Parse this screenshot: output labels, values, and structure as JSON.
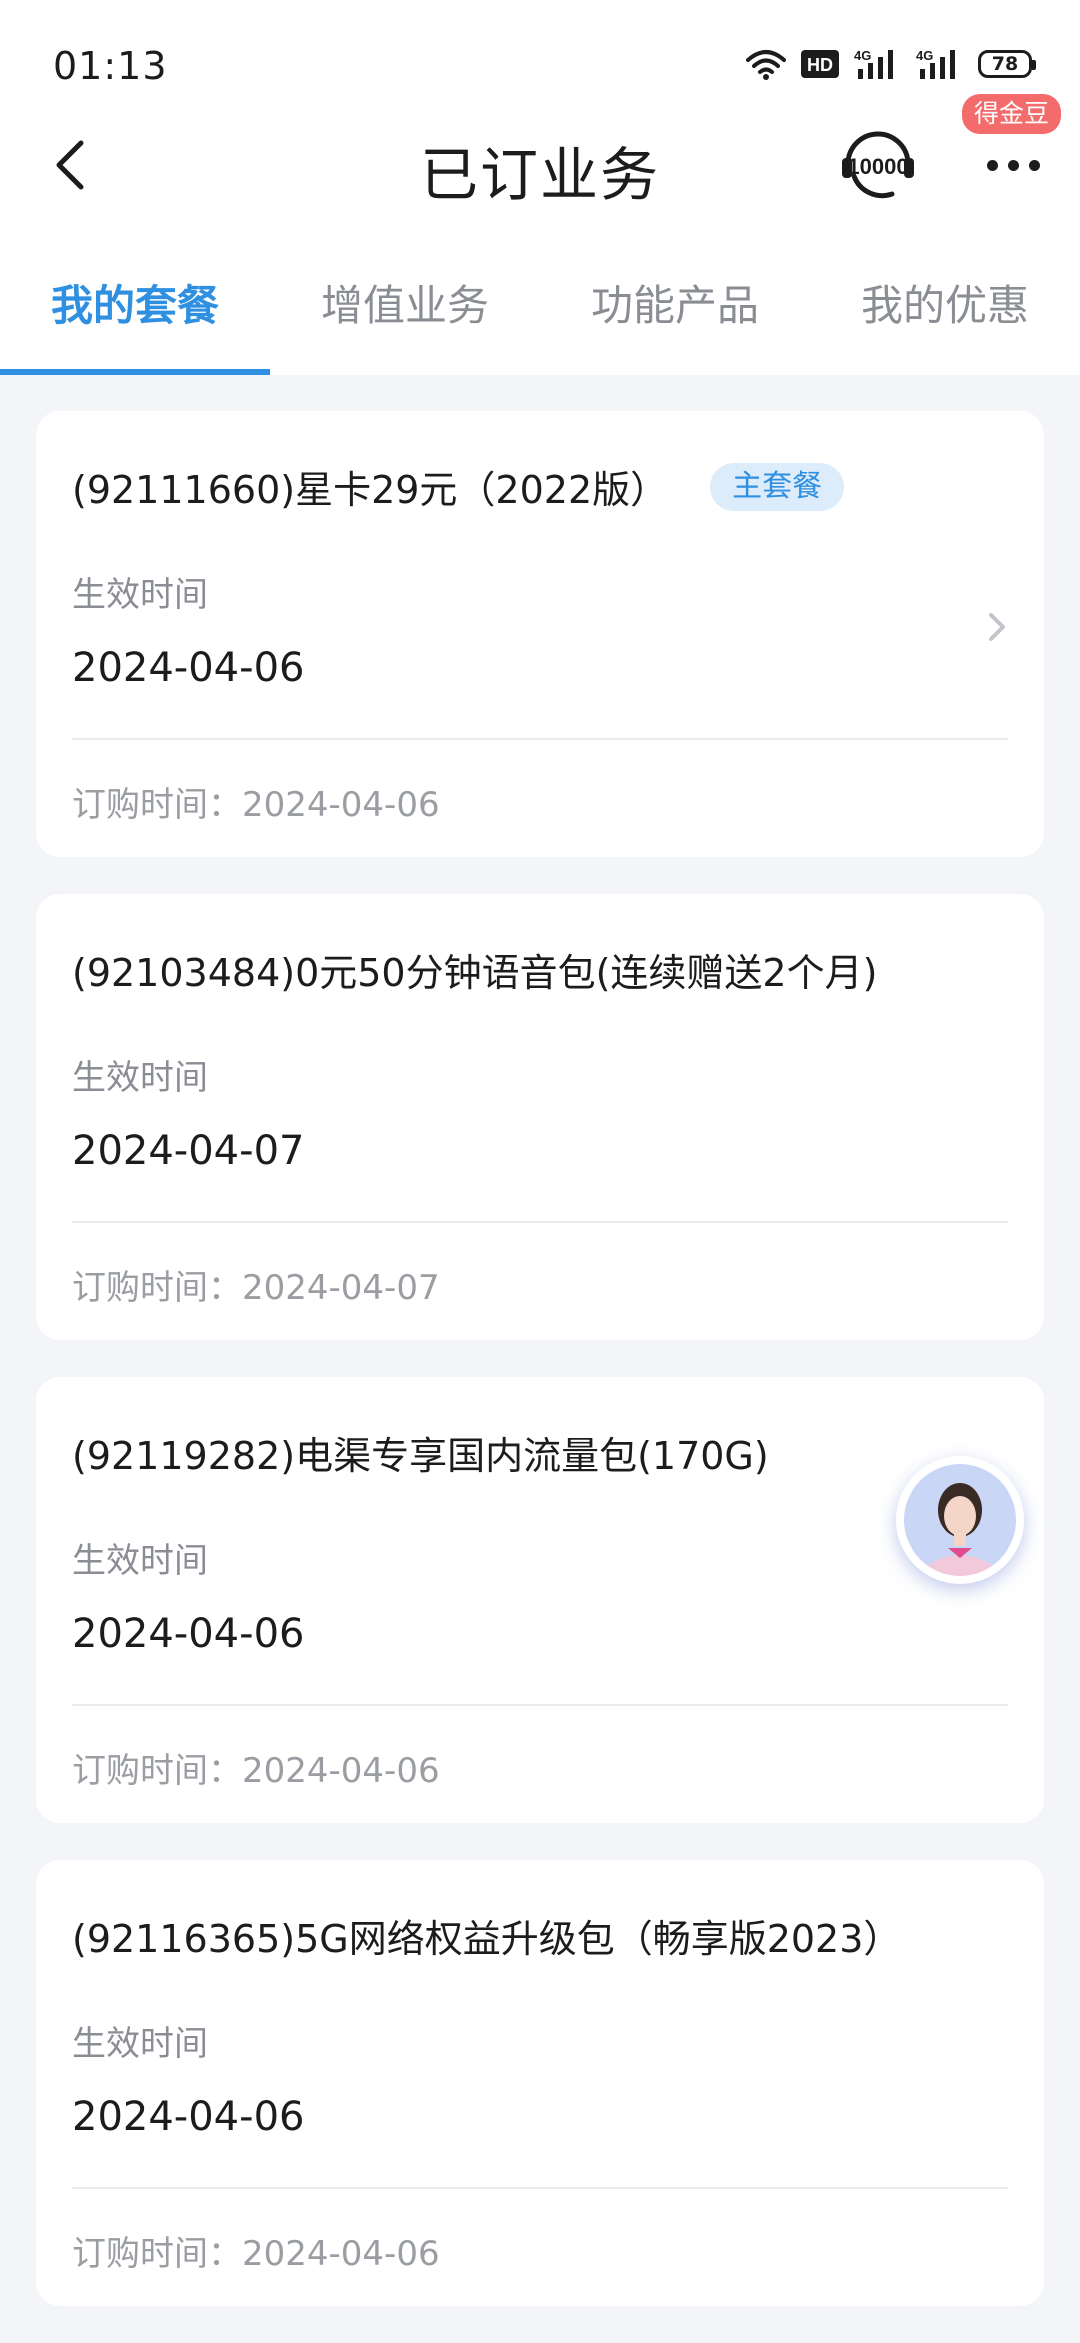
{
  "status_bar": {
    "time": "01:13",
    "battery": "78",
    "network_1": "4G",
    "network_2": "4G",
    "hd_label": "HD"
  },
  "header": {
    "title": "已订业务",
    "coin_badge": "得金豆",
    "service_icon": "service-10000-icon"
  },
  "tabs": [
    {
      "label": "我的套餐",
      "active": true
    },
    {
      "label": "增值业务",
      "active": false
    },
    {
      "label": "功能产品",
      "active": false
    },
    {
      "label": "我的优惠",
      "active": false
    }
  ],
  "labels": {
    "effective": "生效时间",
    "order_prefix": "订购时间："
  },
  "packages": [
    {
      "title": "(92111660)星卡29元（2022版）",
      "tag": "主套餐",
      "effective_date": "2024-04-06",
      "order_date": "2024-04-06"
    },
    {
      "title": "(92103484)0元50分钟语音包(连续赠送2个月)",
      "effective_date": "2024-04-07",
      "order_date": "2024-04-07"
    },
    {
      "title": "(92119282)电渠专享国内流量包(170G)",
      "effective_date": "2024-04-06",
      "order_date": "2024-04-06"
    },
    {
      "title": "(92116365)5G网络权益升级包（畅享版2023）",
      "effective_date": "2024-04-06",
      "order_date": "2024-04-06"
    }
  ],
  "colors": {
    "accent": "#2f8fe0",
    "badge": "#f36b6b",
    "tag_bg": "#dcecfb",
    "page_bg": "#f3f5f8"
  }
}
